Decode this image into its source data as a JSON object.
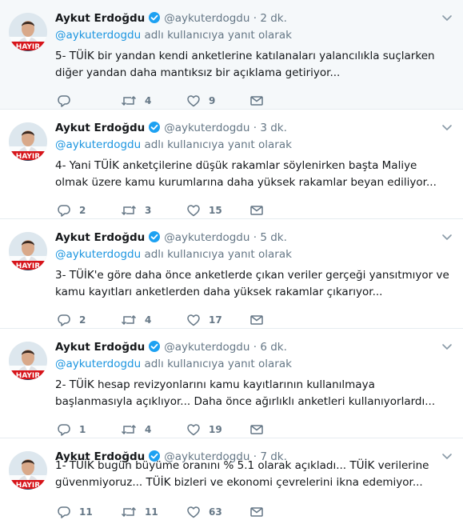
{
  "colors": {
    "link": "#1b95e0",
    "secondary_text": "#657786",
    "verified_badge": "#1da1f2",
    "highlight_bg": "#f5f8fa",
    "avatar_banner_red": "#d7141a"
  },
  "icons": {
    "reply": "reply-icon",
    "retweet": "retweet-icon",
    "like": "heart-icon",
    "dm": "envelope-icon",
    "verified": "verified-badge-icon",
    "caret": "chevron-down-icon"
  },
  "tweets": [
    {
      "name": "Aykut Erdoğdu",
      "handle": "@aykuterdogdu",
      "dot": "·",
      "time": "2 dk.",
      "reply_handle": "@aykuterdogdu",
      "reply_suffix": "adlı kullanıcıya yanıt olarak",
      "text": "5- TÜİK bir yandan kendi anketlerine katılanaları yalancılıkla suçlarken diğer yandan daha mantıksız bir açıklama getiriyor...",
      "replies": "",
      "retweets": "4",
      "likes": "9",
      "avatar_text": "HAYIR"
    },
    {
      "name": "Aykut Erdoğdu",
      "handle": "@aykuterdogdu",
      "dot": "·",
      "time": "3 dk.",
      "reply_handle": "@aykuterdogdu",
      "reply_suffix": "adlı kullanıcıya yanıt olarak",
      "text": "4- Yani TÜİK anketçilerine düşük rakamlar söylenirken başta Maliye olmak üzere kamu kurumlarına daha yüksek rakamlar beyan ediliyor...",
      "replies": "2",
      "retweets": "3",
      "likes": "15",
      "avatar_text": "HAYIR"
    },
    {
      "name": "Aykut Erdoğdu",
      "handle": "@aykuterdogdu",
      "dot": "·",
      "time": "5 dk.",
      "reply_handle": "@aykuterdogdu",
      "reply_suffix": "adlı kullanıcıya yanıt olarak",
      "text": "3- TÜİK'e göre daha önce anketlerde çıkan veriler gerçeği yansıtmıyor ve kamu kayıtları anketlerden daha yüksek rakamlar çıkarıyor...",
      "replies": "2",
      "retweets": "4",
      "likes": "17",
      "avatar_text": "HAYIR"
    },
    {
      "name": "Aykut Erdoğdu",
      "handle": "@aykuterdogdu",
      "dot": "·",
      "time": "6 dk.",
      "reply_handle": "@aykuterdogdu",
      "reply_suffix": "adlı kullanıcıya yanıt olarak",
      "text": "2- TÜİK hesap revizyonlarını kamu kayıtlarının kullanılmaya başlanmasıyla açıklıyor... Daha önce ağırlıklı anketleri kullanıyorlardı...",
      "replies": "1",
      "retweets": "4",
      "likes": "19",
      "avatar_text": "HAYIR"
    },
    {
      "name": "Aykut Erdoğdu",
      "handle": "@aykuterdogdu",
      "dot": "·",
      "time": "7 dk.",
      "reply_handle": "",
      "reply_suffix": "",
      "text": "1- TÜİK bugün büyüme oranını % 5.1 olarak açıkladı... TÜİK verilerine güvenmiyoruz... TÜİK bizleri ve ekonomi çevrelerini ikna edemiyor...",
      "replies": "11",
      "retweets": "11",
      "likes": "63",
      "avatar_text": "HAYIR"
    }
  ]
}
